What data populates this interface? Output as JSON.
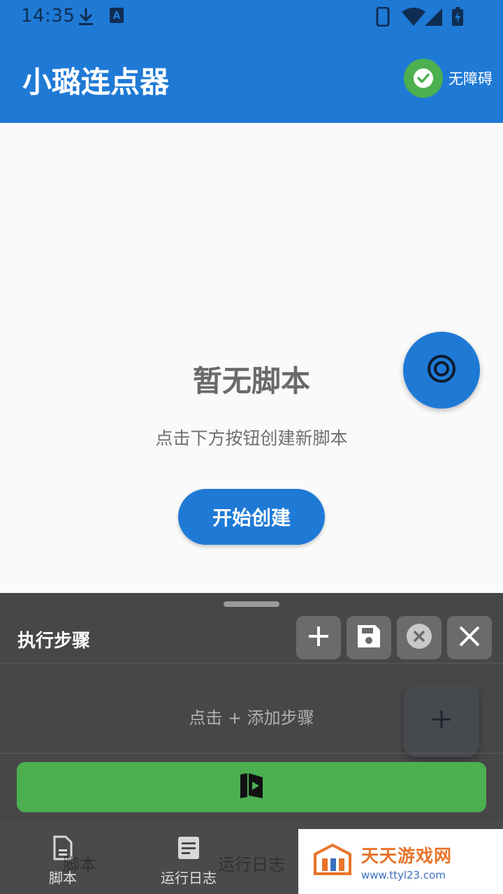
{
  "status_bar": {
    "time": "14:35",
    "icons": [
      "download-icon",
      "a-badge-icon",
      "phone-icon",
      "wifi-icon",
      "signal-icon",
      "battery-charging-icon"
    ]
  },
  "app_bar": {
    "title": "小璐连点器",
    "accessibility_label": "无障碍",
    "accessibility_icon": "check-circle-icon"
  },
  "empty_state": {
    "title": "暂无脚本",
    "subtitle": "点击下方按钮创建新脚本",
    "button_label": "开始创建"
  },
  "floating_target_icon": "target-icon",
  "steps_panel": {
    "title": "执行步骤",
    "toolbar_icons": [
      "plus-icon",
      "save-icon",
      "clear-circle-icon",
      "close-icon"
    ],
    "hint": "点击 + 添加步骤",
    "run_icon": "run-script-icon"
  },
  "bottom_nav": {
    "items": [
      {
        "label": "脚本",
        "icon": "document-icon"
      },
      {
        "label": "运行日志",
        "icon": "log-icon"
      }
    ],
    "shadow_labels": [
      "脚本",
      "运行日志"
    ]
  },
  "watermark": {
    "main": "天天游戏网",
    "sub": "www.ttyl23.com"
  },
  "colors": {
    "primary": "#1f7ad6",
    "success": "#4caf50",
    "panel": "#3c3c3c"
  }
}
